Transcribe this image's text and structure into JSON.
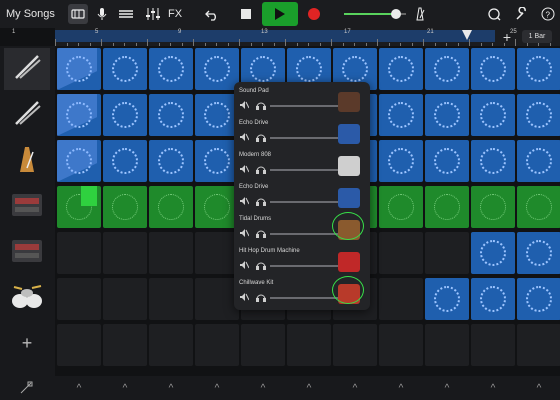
{
  "topbar": {
    "title": "My Songs",
    "fx_label": "FX",
    "icons": [
      "loop-browser-icon",
      "microphone-icon",
      "mixer-icon",
      "eq-icon",
      "undo-icon",
      "stop-icon",
      "play-icon",
      "record-icon",
      "master-volume-icon",
      "metronome-icon",
      "loops-icon",
      "settings-icon",
      "help-icon"
    ],
    "colors": {
      "play": "#1a9f2b",
      "record": "#e02424",
      "volume": "#59d35d"
    }
  },
  "ruler": {
    "markers": [
      "1",
      "5",
      "9",
      "13",
      "17",
      "21",
      "25"
    ],
    "add_label": "+",
    "length_label": "1 Bar"
  },
  "tracks": [
    {
      "icon": "drum-sticks-icon"
    },
    {
      "icon": "drum-sticks-icon"
    },
    {
      "icon": "metronome-instrument-icon"
    },
    {
      "icon": "beat-sequencer-icon"
    },
    {
      "icon": "beat-sequencer-icon"
    },
    {
      "icon": "drum-kit-icon"
    }
  ],
  "add_track_label": "+",
  "grid": {
    "rows": [
      [
        "blue",
        "blue",
        "blue",
        "blue",
        "blue",
        "blue",
        "blue",
        "blue",
        "blue",
        "blue",
        "blue"
      ],
      [
        "blue",
        "blue",
        "blue",
        "blue",
        "blue",
        "blue",
        "blue",
        "blue",
        "blue",
        "blue",
        "blue"
      ],
      [
        "blue",
        "blue",
        "blue",
        "blue",
        "empty",
        "blue",
        "blue",
        "blue",
        "blue",
        "blue",
        "blue"
      ],
      [
        "green",
        "green",
        "green",
        "green",
        "green",
        "green",
        "green",
        "green",
        "green",
        "green",
        "green"
      ],
      [
        "empty",
        "empty",
        "empty",
        "empty",
        "empty",
        "empty",
        "empty",
        "empty",
        "empty",
        "blue",
        "blue"
      ],
      [
        "empty",
        "empty",
        "empty",
        "empty",
        "empty",
        "empty",
        "empty",
        "empty",
        "blue",
        "blue",
        "blue"
      ],
      [
        "empty",
        "empty",
        "empty",
        "empty",
        "empty",
        "empty",
        "empty",
        "empty",
        "empty",
        "empty",
        "empty"
      ]
    ]
  },
  "popover": {
    "rows": [
      {
        "name": "Sound Pad",
        "thumb_color": "#5b3a2a"
      },
      {
        "name": "Echo Drive",
        "thumb_color": "#2b5aa8"
      },
      {
        "name": "Modern 808",
        "thumb_color": "#cfcfcf"
      },
      {
        "name": "Echo Drive",
        "thumb_color": "#2b5aa8"
      },
      {
        "name": "Tidal Drums",
        "thumb_color": "#8a5a2e"
      },
      {
        "name": "Hit Hop Drum Machine",
        "thumb_color": "#c02828"
      },
      {
        "name": "Chillwave Kit",
        "thumb_color": "#b83a2a"
      }
    ]
  },
  "footer": {
    "chevron": "^"
  }
}
